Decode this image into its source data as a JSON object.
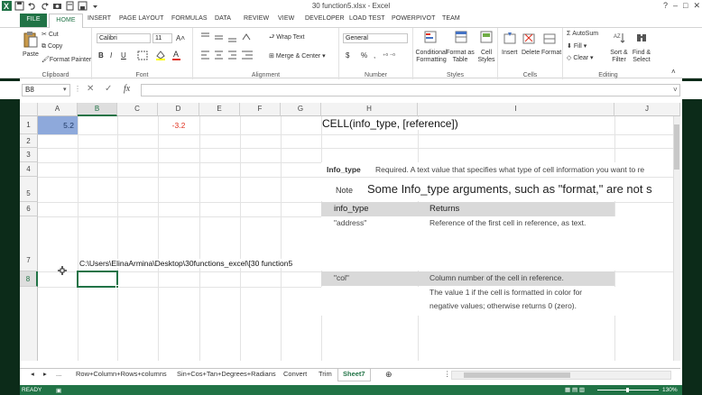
{
  "window": {
    "title": "30 function5.xlsx - Excel",
    "controls": [
      "?",
      "–",
      "□",
      "✕"
    ]
  },
  "tabs": [
    "FILE",
    "HOME",
    "INSERT",
    "PAGE LAYOUT",
    "FORMULAS",
    "DATA",
    "REVIEW",
    "VIEW",
    "DEVELOPER",
    "LOAD TEST",
    "POWERPIVOT",
    "TEAM"
  ],
  "ribbon": {
    "clipboard": {
      "paste": "Paste",
      "cut": "Cut",
      "copy": "Copy",
      "format_painter": "Format Painter",
      "label": "Clipboard"
    },
    "font": {
      "font_name": "Calibri",
      "font_size": "11",
      "bold": "B",
      "italic": "I",
      "underline": "U",
      "label": "Font"
    },
    "alignment": {
      "wrap_text": "Wrap Text",
      "merge_center": "Merge & Center",
      "label": "Alignment"
    },
    "number": {
      "format": "General",
      "currency": "$",
      "percent": "%",
      "comma": ",",
      "label": "Number"
    },
    "styles": {
      "conditional": "Conditional Formatting",
      "format_table": "Format as Table",
      "cell_styles": "Cell Styles",
      "label": "Styles"
    },
    "cells": {
      "insert": "Insert",
      "delete": "Delete",
      "format": "Format",
      "label": "Cells"
    },
    "editing": {
      "autosum": "AutoSum",
      "fill": "Fill",
      "clear": "Clear",
      "sort_filter": "Sort & Filter",
      "find_select": "Find & Select",
      "label": "Editing"
    }
  },
  "formula_bar": {
    "name_box": "B8",
    "fx": "fx",
    "formula": ""
  },
  "columns": [
    "A",
    "B",
    "C",
    "D",
    "E",
    "F",
    "G",
    "H",
    "I",
    "J"
  ],
  "rows": [
    "1",
    "2",
    "3",
    "4",
    "5",
    "6",
    "7",
    "8"
  ],
  "cells": {
    "A1": "5.2",
    "D1": "-3.2",
    "H1": "CELL(info_type, [reference])",
    "H4_label": "Info_type",
    "H4_text": "Required. A text value that specifies what type of cell information you want to re",
    "H5_label": "Note",
    "H5_text": "Some Info_type arguments, such as \"format,\" are not s",
    "H6": "info_type",
    "I6": "Returns",
    "H6b": "\"address\"",
    "I6b": "Reference of the first cell in reference, as text.",
    "B7": "C:\\Users\\ElinaArmina\\Desktop\\30functions_excel\\[30 function5",
    "H8": "\"col\"",
    "I8": "Column number of the cell in reference.",
    "I8b": "The value 1 if the cell is formatted in color for",
    "I8c": "negative values; otherwise returns 0 (zero)."
  },
  "sheet_tabs": [
    "...",
    "Row+Column+Rows+columns",
    "Sin+Cos+Tan+Degrees+Radians",
    "Convert",
    "Trim",
    "Sheet7"
  ],
  "status": {
    "ready": "READY",
    "zoom": "130%"
  },
  "colors": {
    "accent": "#217346",
    "selected_cell_fill": "#8ea9db",
    "negative": "#e0301e",
    "header_fill": "#d9d9d9"
  }
}
